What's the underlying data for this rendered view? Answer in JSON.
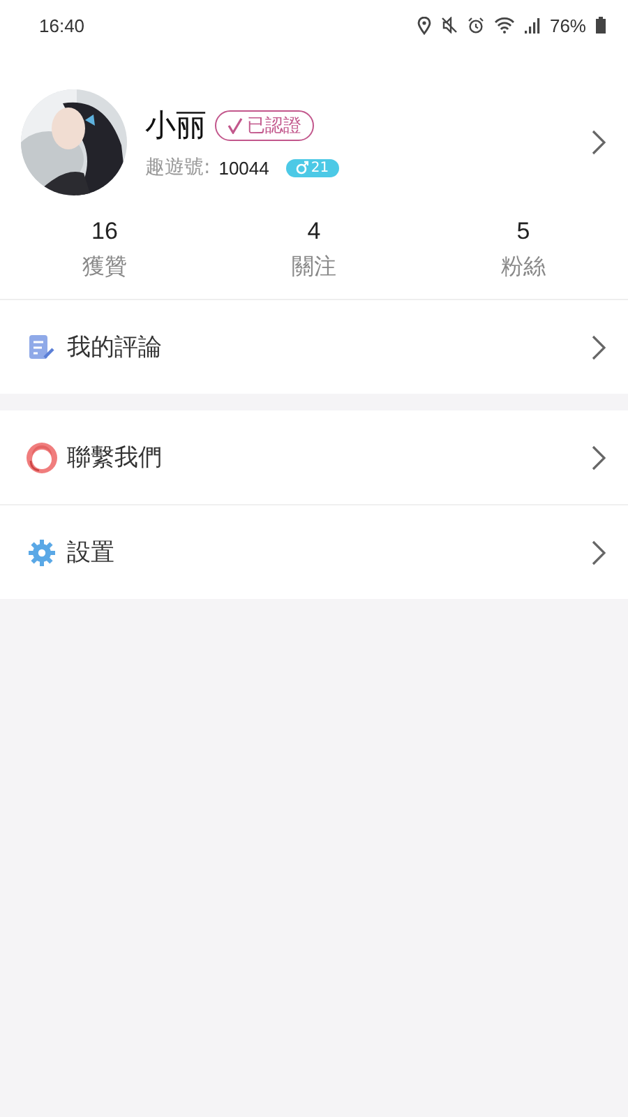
{
  "status_bar": {
    "time": "16:40",
    "battery": "76%"
  },
  "profile": {
    "name": "小丽",
    "verified": {
      "label": "已認證"
    },
    "id_label": "趣遊號:",
    "id_value": "10044",
    "gender": {
      "kind": "male",
      "age": "21"
    }
  },
  "stats": [
    {
      "value": "16",
      "label": "獲贊"
    },
    {
      "value": "4",
      "label": "關注"
    },
    {
      "value": "5",
      "label": "粉絲"
    }
  ],
  "menu_groups": [
    [
      {
        "kind": "comments",
        "label": "我的評論"
      }
    ],
    [
      {
        "kind": "contact",
        "label": "聯繫我們"
      },
      {
        "kind": "settings",
        "label": "設置"
      }
    ]
  ]
}
